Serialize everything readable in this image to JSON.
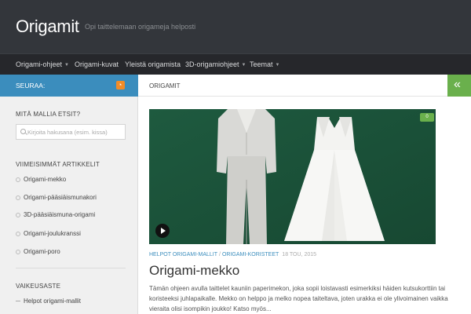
{
  "header": {
    "site_title": "Origamit",
    "tagline": "Opi taittelemaan origameja helposti"
  },
  "nav": {
    "items": [
      {
        "label": "Origami-ohjeet",
        "has_dropdown": true
      },
      {
        "label": "Origami-kuvat",
        "has_dropdown": false
      },
      {
        "label": "Yleistä origamista",
        "has_dropdown": false
      },
      {
        "label": "3D-origamiohjeet",
        "has_dropdown": true
      },
      {
        "label": "Teemat",
        "has_dropdown": true
      }
    ],
    "caret": "▼"
  },
  "sidebar": {
    "follow_label": "SEURAA:",
    "rss_icon": "rss-icon",
    "search": {
      "title": "MITÄ MALLIA ETSIT?",
      "placeholder": "Kirjoita hakusana (esim. kissa)"
    },
    "recent": {
      "title": "VIIMEISIMMÄT ARTIKKELIT",
      "items": [
        "Origami-mekko",
        "Origami-pääsiäismunakori",
        "3D-pääsiäismuna-origami",
        "Origami-joulukranssi",
        "Origami-poro"
      ]
    },
    "difficulty": {
      "title": "VAIKEUSASTE",
      "items": [
        "Helpot origami-mallit"
      ]
    }
  },
  "main": {
    "crumb": "ORIGAMIT",
    "toggle_glyph": "«",
    "post": {
      "comment_count": "0",
      "categories": [
        "HELPOT ORIGAMI-MALLIT",
        "ORIGAMI-KORISTEET"
      ],
      "separator": "/",
      "date": "18 TOU, 2015",
      "title": "Origami-mekko",
      "excerpt": "Tämän ohjeen avulla taittelet kauniin paperimekon, joka sopii loistavasti esimerkiksi häiden kutsukorttiin tai koristeeksi juhlapaikalle. Mekko on helppo ja melko nopea taiteltava, joten urakka ei ole ylivoimainen vaikka vieraita olisi isompikin joukko! Katso myös..."
    }
  },
  "colors": {
    "header_bg": "#33363b",
    "nav_bg": "#26272b",
    "accent_blue": "#3b8dbd",
    "accent_green": "#6ab04c",
    "rss_orange": "#f28c28"
  }
}
